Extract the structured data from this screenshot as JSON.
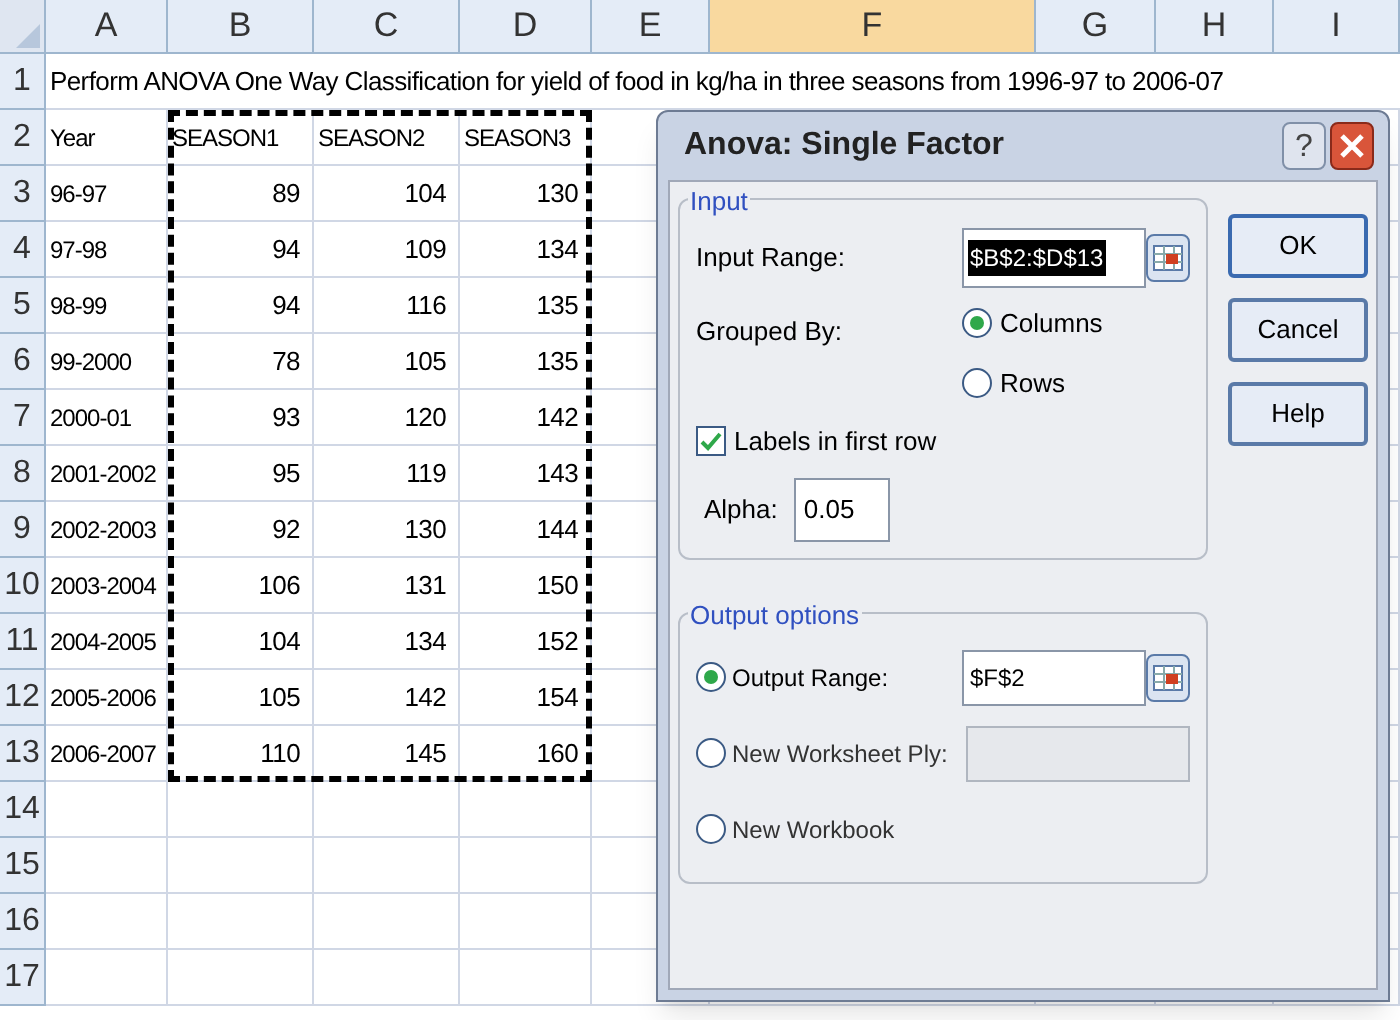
{
  "spreadsheet": {
    "columns": [
      {
        "label": "A",
        "selected": false
      },
      {
        "label": "B",
        "selected": false
      },
      {
        "label": "C",
        "selected": false
      },
      {
        "label": "D",
        "selected": false
      },
      {
        "label": "E",
        "selected": false
      },
      {
        "label": "F",
        "selected": true
      },
      {
        "label": "G",
        "selected": false
      },
      {
        "label": "H",
        "selected": false
      },
      {
        "label": "I",
        "selected": false
      }
    ],
    "rows": [
      {
        "number": "1",
        "title": "Perform ANOVA One Way Classification for yield of food in kg/ha in three seasons from 1996-97 to 2006-07"
      },
      {
        "number": "2",
        "cells": [
          "Year",
          "SEASON1",
          "SEASON2",
          "SEASON3"
        ]
      },
      {
        "number": "3",
        "cells": [
          "96-97",
          "89",
          "104",
          "130"
        ]
      },
      {
        "number": "4",
        "cells": [
          "97-98",
          "94",
          "109",
          "134"
        ]
      },
      {
        "number": "5",
        "cells": [
          "98-99",
          "94",
          "116",
          "135"
        ]
      },
      {
        "number": "6",
        "cells": [
          "99-2000",
          "78",
          "105",
          "135"
        ]
      },
      {
        "number": "7",
        "cells": [
          "2000-01",
          "93",
          "120",
          "142"
        ]
      },
      {
        "number": "8",
        "cells": [
          "2001-2002",
          "95",
          "119",
          "143"
        ]
      },
      {
        "number": "9",
        "cells": [
          "2002-2003",
          "92",
          "130",
          "144"
        ]
      },
      {
        "number": "10",
        "cells": [
          "2003-2004",
          "106",
          "131",
          "150"
        ]
      },
      {
        "number": "11",
        "cells": [
          "2004-2005",
          "104",
          "134",
          "152"
        ]
      },
      {
        "number": "12",
        "cells": [
          "2005-2006",
          "105",
          "142",
          "154"
        ]
      },
      {
        "number": "13",
        "cells": [
          "2006-2007",
          "110",
          "145",
          "160"
        ]
      },
      {
        "number": "14"
      },
      {
        "number": "15"
      },
      {
        "number": "16"
      },
      {
        "number": "17"
      }
    ]
  },
  "dialog": {
    "title": "Anova: Single Factor",
    "help_glyph": "?",
    "input": {
      "legend": "Input",
      "input_range": {
        "label": "Input Range:",
        "value": "$B$2:$D$13",
        "highlighted": true
      },
      "grouped_by": {
        "label": "Grouped By:",
        "options": [
          {
            "label": "Columns",
            "selected": true
          },
          {
            "label": "Rows",
            "selected": false
          }
        ]
      },
      "labels_in_first_row": {
        "label": "Labels in first row",
        "checked": true
      },
      "alpha": {
        "label": "Alpha:",
        "value": "0.05"
      }
    },
    "output": {
      "legend": "Output options",
      "options": [
        {
          "kind": "range",
          "label": "Output Range:",
          "selected": true,
          "value": "$F$2"
        },
        {
          "kind": "field",
          "label": "New Worksheet Ply:",
          "selected": false
        },
        {
          "kind": "plain",
          "label": "New Workbook",
          "selected": false
        }
      ]
    },
    "buttons": [
      "OK",
      "Cancel",
      "Help"
    ]
  }
}
